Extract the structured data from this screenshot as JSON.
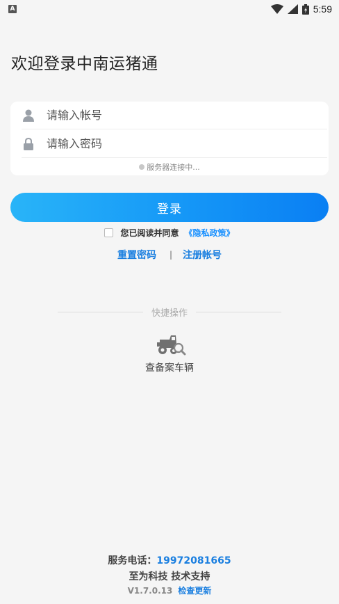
{
  "status_bar": {
    "notification_icon": "A",
    "time": "5:59",
    "icons": [
      "wifi-icon",
      "signal-icon",
      "battery-icon"
    ]
  },
  "welcome_title": "欢迎登录中南运猪通",
  "form": {
    "account_placeholder": "请输入帐号",
    "password_placeholder": "请输入密码",
    "connection_status": "服务器连接中..."
  },
  "login_button": "登录",
  "agreement": {
    "text": "您已阅读并同意",
    "privacy_link": "《隐私政策》"
  },
  "links": {
    "reset_password": "重置密码",
    "separator": "|",
    "register": "注册帐号"
  },
  "quick_ops": {
    "title": "快捷操作",
    "items": [
      {
        "label": "查备案车辆",
        "icon": "tractor-search-icon"
      }
    ]
  },
  "footer": {
    "phone_label": "服务电话：",
    "phone": "19972081665",
    "support": "至为科技 技术支持",
    "version": "V1.7.0.13",
    "check_update": "检查更新"
  },
  "colors": {
    "accent": "#1890ff",
    "background": "#f5f5f5",
    "button_gradient_start": "#29b4f8",
    "button_gradient_end": "#0a7ff3"
  }
}
